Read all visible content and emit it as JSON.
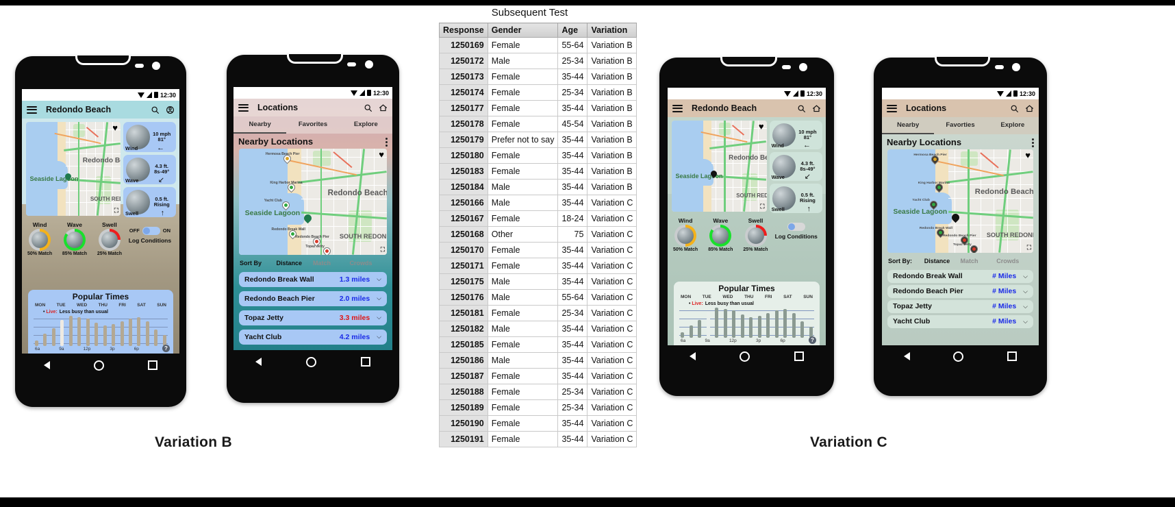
{
  "page": {
    "bg": "#ffffff",
    "bar_color": "#000000"
  },
  "table": {
    "title": "Subsequent Test",
    "columns": [
      "Response",
      "Gender",
      "Age",
      "Variation"
    ],
    "rows": [
      [
        "1250169",
        "Female",
        "55-64",
        "Variation B"
      ],
      [
        "1250172",
        "Male",
        "25-34",
        "Variation B"
      ],
      [
        "1250173",
        "Female",
        "35-44",
        "Variation B"
      ],
      [
        "1250174",
        "Female",
        "25-34",
        "Variation B"
      ],
      [
        "1250177",
        "Female",
        "35-44",
        "Variation B"
      ],
      [
        "1250178",
        "Female",
        "45-54",
        "Variation B"
      ],
      [
        "1250179",
        "Prefer not to say",
        "35-44",
        "Variation B"
      ],
      [
        "1250180",
        "Female",
        "35-44",
        "Variation B"
      ],
      [
        "1250183",
        "Female",
        "35-44",
        "Variation B"
      ],
      [
        "1250184",
        "Male",
        "35-44",
        "Variation B"
      ],
      [
        "1250166",
        "Male",
        "35-44",
        "Variation C"
      ],
      [
        "1250167",
        "Female",
        "18-24",
        "Variation C"
      ],
      [
        "1250168",
        "Other",
        "75",
        "Variation C"
      ],
      [
        "1250170",
        "Female",
        "35-44",
        "Variation C"
      ],
      [
        "1250171",
        "Female",
        "35-44",
        "Variation C"
      ],
      [
        "1250175",
        "Male",
        "35-44",
        "Variation C"
      ],
      [
        "1250176",
        "Male",
        "55-64",
        "Variation C"
      ],
      [
        "1250181",
        "Female",
        "25-34",
        "Variation C"
      ],
      [
        "1250182",
        "Male",
        "35-44",
        "Variation C"
      ],
      [
        "1250185",
        "Female",
        "35-44",
        "Variation C"
      ],
      [
        "1250186",
        "Male",
        "35-44",
        "Variation C"
      ],
      [
        "1250187",
        "Female",
        "35-44",
        "Variation C"
      ],
      [
        "1250188",
        "Female",
        "25-34",
        "Variation C"
      ],
      [
        "1250189",
        "Female",
        "25-34",
        "Variation C"
      ],
      [
        "1250190",
        "Female",
        "35-44",
        "Variation C"
      ],
      [
        "1250191",
        "Female",
        "35-44",
        "Variation C"
      ]
    ]
  },
  "captions": {
    "variation_b": "Variation B",
    "variation_c": "Variation C"
  },
  "status_bar": {
    "time": "12:30",
    "wifi_icon": "wifi-icon",
    "signal_icon": "signal-icon",
    "battery_icon": "battery-icon"
  },
  "theme_b": {
    "appbar": "#a9dbe0",
    "page": "#cfe8ec",
    "card": "#a8c8f5",
    "panel": "#a8c8f5",
    "toggle": "#a8c8f5"
  },
  "theme_c": {
    "appbar": "#d9c3ae",
    "page": "#c3d6cb",
    "card": "#cfe3da",
    "panel": "#e6efe9",
    "toggle": "#d8d8d8"
  },
  "home_screen": {
    "title": "Redondo Beach",
    "menu_icon": "hamburger-menu-icon",
    "search_icon": "search-icon",
    "account_icon": "account-avatar-icon",
    "home_icon": "home-icon",
    "favorite_icon": "heart-icon",
    "expand_icon": "expand-map-icon",
    "map": {
      "place_label": "Redondo Beach",
      "lagoon_label": "Seaside Lagoon",
      "district_label": "SOUTH REDONDO",
      "pin_icon": "map-pin-icon"
    },
    "cards": [
      {
        "label": "Wind",
        "value": "10 mph",
        "value2": "81°",
        "arrow": "←",
        "icon": "wind-dial-icon"
      },
      {
        "label": "Wave",
        "value": "4.3 ft.",
        "value2": "8s-49°",
        "arrow": "↙",
        "icon": "wave-dial-icon"
      },
      {
        "label": "Swell",
        "value": "0.5 ft.",
        "value2": "Rising",
        "arrow": "↑",
        "icon": "swell-dial-icon"
      }
    ],
    "gauges": [
      {
        "name": "Wind",
        "match": "50% Match",
        "pct": 50,
        "color": "#f4b21b"
      },
      {
        "name": "Wave",
        "match": "85% Match",
        "pct": 85,
        "color": "#19e02c"
      },
      {
        "name": "Swell",
        "match": "25% Match",
        "pct": 25,
        "color": "#ef1c1c"
      }
    ],
    "toggle": {
      "off_label": "OFF",
      "on_label": "ON",
      "caption": "Log Conditions"
    },
    "popular_times": {
      "title": "Popular Times",
      "days": [
        "MON",
        "TUE",
        "WED",
        "THU",
        "FRI",
        "SAT",
        "SUN"
      ],
      "live_prefix": "Live:",
      "live_text": "Less busy than usual",
      "hours": [
        "6a",
        "9a",
        "12p",
        "3p",
        "6p"
      ],
      "bars": [
        8,
        18,
        26,
        38,
        44,
        42,
        40,
        34,
        30,
        32,
        36,
        40,
        42,
        36,
        24,
        16
      ],
      "now_index": 3,
      "help_icon": "help-icon",
      "help_label": "?"
    }
  },
  "locations_screen": {
    "title": "Locations",
    "menu_icon": "hamburger-menu-icon",
    "search_icon": "search-icon",
    "home_icon": "home-icon",
    "tabs": [
      {
        "label": "Nearby",
        "selected": true
      },
      {
        "label": "Favorites",
        "selected": false
      },
      {
        "label": "Explore",
        "selected": false
      }
    ],
    "tabs_c": [
      {
        "label": "Nearby",
        "selected": true
      },
      {
        "label": "Favorties",
        "selected": false
      },
      {
        "label": "Explore",
        "selected": false
      }
    ],
    "section_title": "Nearby Locations",
    "overflow_icon": "more-vertical-icon",
    "favorite_icon": "heart-icon",
    "expand_icon": "expand-map-icon",
    "map_labels": [
      "Hermosa Beach Pier",
      "King Harbor Marina",
      "Yacht Club",
      "Seaside Lagoon",
      "Redondo Break Wall",
      "Redondo Beach Pier",
      "Topaz Jetty",
      "Redondo Beach",
      "SOUTH REDONDO"
    ],
    "sort_b": {
      "label": "Sort By",
      "options": [
        "Distance",
        "Match",
        "Crowds"
      ],
      "selected": "Distance"
    },
    "sort_c": {
      "label": "Sort By:",
      "options": [
        "Distance",
        "Match",
        "Crowds"
      ],
      "selected": "Distance"
    },
    "list_b": [
      {
        "name": "Redondo Break Wall",
        "distance": "1.3 miles",
        "color": "#1a2ae8"
      },
      {
        "name": "Redondo Beach Pier",
        "distance": "2.0 miles",
        "color": "#1a2ae8"
      },
      {
        "name": "Topaz Jetty",
        "distance": "3.3 miles",
        "color": "#e01414"
      },
      {
        "name": "Yacht Club",
        "distance": "4.2 miles",
        "color": "#1a2ae8"
      }
    ],
    "list_c": [
      {
        "name": "Redondo Break Wall",
        "distance": "# Miles",
        "color": "#1a2ae8"
      },
      {
        "name": "Redondo Beach Pier",
        "distance": "# Miles",
        "color": "#1a2ae8"
      },
      {
        "name": "Topaz Jetty",
        "distance": "# Miles",
        "color": "#1a2ae8"
      },
      {
        "name": "Yacht Club",
        "distance": "# Miles",
        "color": "#1a2ae8"
      }
    ],
    "chevron_icon": "chevron-down-icon"
  },
  "nav": {
    "back_icon": "nav-back-icon",
    "home_icon": "nav-home-icon",
    "recents_icon": "nav-recents-icon"
  }
}
